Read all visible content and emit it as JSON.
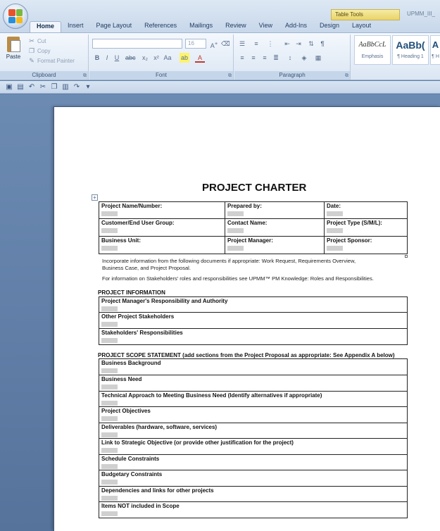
{
  "title_bar": {
    "context_tab": "Table Tools",
    "window_title": "UPMM_III_"
  },
  "tabs": [
    "Home",
    "Insert",
    "Page Layout",
    "References",
    "Mailings",
    "Review",
    "View",
    "Add-Ins",
    "Design",
    "Layout"
  ],
  "ribbon": {
    "clipboard": {
      "paste": "Paste",
      "cut": "Cut",
      "copy": "Copy",
      "format_painter": "Format Painter",
      "label": "Clipboard"
    },
    "font": {
      "size": "16",
      "label": "Font"
    },
    "paragraph": {
      "label": "Paragraph"
    },
    "styles": [
      {
        "sample": "AaBbCcL",
        "name": "Emphasis"
      },
      {
        "sample": "AaBb(",
        "name": "¶ Heading 1"
      },
      {
        "sample": "A",
        "name": "¶ H"
      }
    ]
  },
  "document": {
    "title": "PROJECT CHARTER",
    "header_table": [
      [
        "Project Name/Number:",
        "Prepared by:",
        "Date:"
      ],
      [
        "Customer/End User Group:",
        "Contact Name:",
        "Project Type (S/M/L):"
      ],
      [
        "Business Unit:",
        "Project Manager:",
        "Project Sponsor:"
      ]
    ],
    "note_1_line_1": "Incorporate information from the following documents if appropriate: Work Request, Requirements Overview,",
    "note_1_line_2": "Business Case, and Project Proposal.",
    "note_2": "For information on Stakeholders' roles and responsibilities see UPMM™ PM Knowledge: Roles and Responsibilities.",
    "project_info_heading": "PROJECT INFORMATION",
    "project_info_rows": [
      "Project Manager's Responsibility and Authority",
      "Other Project Stakeholders",
      "Stakeholders' Responsibilities"
    ],
    "scope_heading": "PROJECT SCOPE STATEMENT (add sections from the Project Proposal as appropriate:  See Appendix A below)",
    "scope_rows": [
      "Business Background",
      "Business Need",
      "Technical Approach to Meeting Business Need (Identify alternatives if appropriate)",
      "Project Objectives",
      "Deliverables (hardware, software, services)",
      "Link to Strategic Objective (or provide other justification for the project)",
      "Schedule Constraints",
      "Budgetary Constraints",
      "Dependencies and links for other projects",
      "Items NOT included in Scope"
    ]
  }
}
